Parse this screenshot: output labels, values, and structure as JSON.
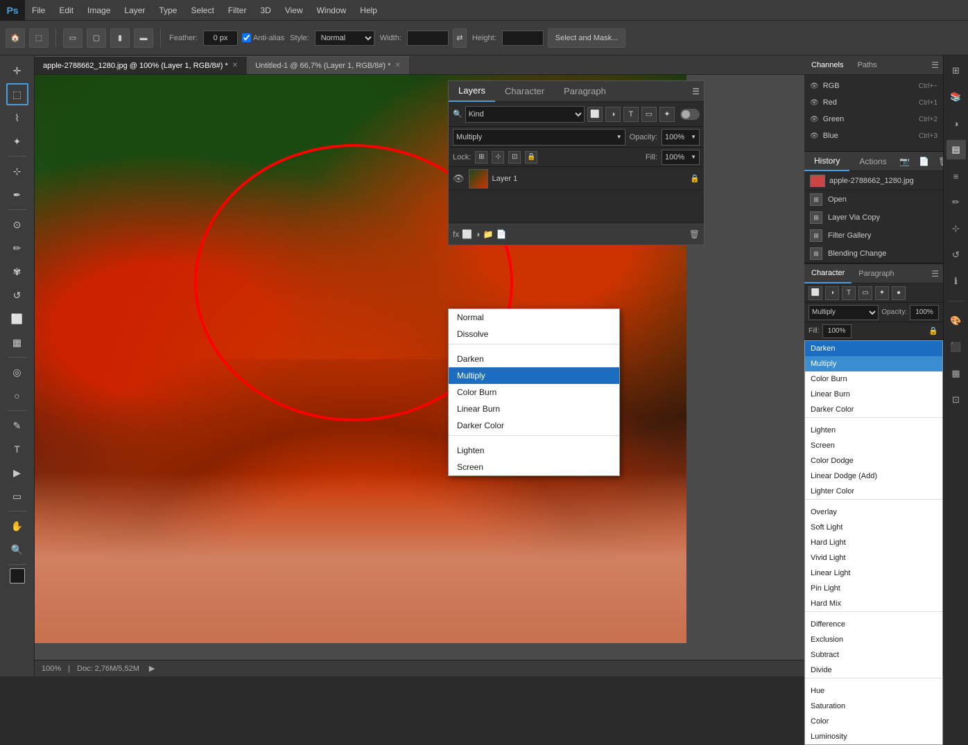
{
  "app": {
    "title": "Adobe Photoshop",
    "logo": "Ps"
  },
  "menu": {
    "items": [
      "File",
      "Edit",
      "Image",
      "Layer",
      "Type",
      "Select",
      "Filter",
      "3D",
      "View",
      "Window",
      "Help"
    ]
  },
  "toolbar": {
    "feather_label": "Feather:",
    "feather_value": "0 px",
    "antialiased_label": "Anti-alias",
    "style_label": "Style:",
    "style_value": "Normal",
    "width_label": "Width:",
    "height_label": "Height:",
    "select_mask_btn": "Select and Mask..."
  },
  "canvas_tabs": [
    {
      "name": "apple-2788662_1280.jpg @ 100% (Layer 1, RGB/8#)",
      "active": true,
      "modified": true
    },
    {
      "name": "Untitled-1 @ 66,7% (Layer 1, RGB/8#)",
      "active": false,
      "modified": true
    }
  ],
  "status_bar": {
    "zoom": "100%",
    "doc_size": "Doc: 2,76M/5,52M"
  },
  "history_panel": {
    "tabs": [
      "History",
      "Actions"
    ],
    "file_name": "apple-2788662_1280.jpg",
    "items": [
      "Open",
      "Layer Via Copy",
      "Filter Gallery",
      "Blending Change"
    ]
  },
  "layers_panel": {
    "tabs": [
      "Layers",
      "Character",
      "Paragraph"
    ],
    "kind_label": "Kind",
    "blend_mode": "Multiply",
    "opacity_label": "Opacity:",
    "opacity_value": "100%",
    "fill_label": "Fill:",
    "fill_value": "100%"
  },
  "blend_dropdown": {
    "items": [
      {
        "label": "Normal",
        "group": 1
      },
      {
        "label": "Dissolve",
        "group": 1
      },
      {
        "label": "Darken",
        "group": 2
      },
      {
        "label": "Multiply",
        "group": 2,
        "selected": true
      },
      {
        "label": "Color Burn",
        "group": 2
      },
      {
        "label": "Linear Burn",
        "group": 2
      },
      {
        "label": "Darker Color",
        "group": 2
      },
      {
        "label": "Lighten",
        "group": 3
      },
      {
        "label": "Screen",
        "group": 3
      }
    ]
  },
  "right_panel2": {
    "tabs": [
      "Character",
      "Paragraph"
    ],
    "blend_mode": "Multiply",
    "opacity_label": "Opacity:",
    "opacity_value": "100%",
    "fill_label": "Fill:",
    "fill_value": "100%"
  },
  "right_panel2_dropdown": {
    "items": [
      {
        "label": "Darken"
      },
      {
        "label": "Multiply",
        "selected": true
      },
      {
        "label": "Color Burn"
      },
      {
        "label": "Linear Burn"
      },
      {
        "label": "Darker Color"
      },
      {
        "label": "Lighten"
      },
      {
        "label": "Screen"
      },
      {
        "label": "Color Dodge"
      },
      {
        "label": "Linear Dodge (Add)"
      },
      {
        "label": "Lighter Color"
      },
      {
        "label": "Overlay"
      },
      {
        "label": "Soft Light"
      },
      {
        "label": "Hard Light"
      },
      {
        "label": "Vivid Light"
      },
      {
        "label": "Linear Light"
      },
      {
        "label": "Pin Light"
      },
      {
        "label": "Hard Mix"
      },
      {
        "label": "Difference"
      },
      {
        "label": "Exclusion"
      },
      {
        "label": "Subtract"
      },
      {
        "label": "Divide"
      },
      {
        "label": "Hue"
      },
      {
        "label": "Saturation"
      },
      {
        "label": "Color"
      },
      {
        "label": "Luminosity"
      }
    ]
  },
  "channels_section": {
    "tabs": [
      "Channels",
      "Paths"
    ],
    "paths_label": "Paths"
  },
  "icons": {
    "eye": "👁",
    "lock": "🔒",
    "search": "🔍",
    "plus": "+",
    "trash": "🗑",
    "camera": "📷",
    "history_back": "↩",
    "layers_icon": "≡",
    "fx": "fx",
    "new_layer": "📄",
    "folder": "📁"
  }
}
